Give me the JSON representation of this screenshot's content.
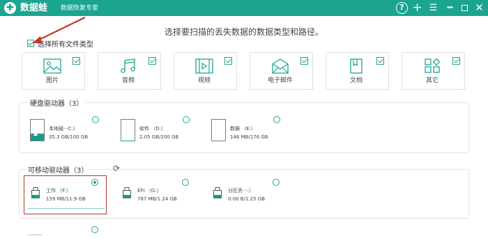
{
  "titlebar": {
    "app_name": "数据蛙",
    "subtitle": "数据恢复专家",
    "logo_glyph": "✚"
  },
  "instruction": "选择要扫描的丢失数据的数据类型和路径。",
  "select_all_label": "选择所有文件类型",
  "file_types": [
    {
      "label": "图片",
      "checked": true
    },
    {
      "label": "音频",
      "checked": true
    },
    {
      "label": "视频",
      "checked": true
    },
    {
      "label": "电子邮件",
      "checked": true
    },
    {
      "label": "文档",
      "checked": true
    },
    {
      "label": "其它",
      "checked": true
    }
  ],
  "hard_drives": {
    "title": "硬盘驱动器（3）",
    "items": [
      {
        "name": "本地磁···C:）",
        "size": "35.3 GB/100 GB",
        "used_fraction": 0.35
      },
      {
        "name": "软件 （D:）",
        "size": "2.05 GB/200 GB",
        "used_fraction": 0.01
      },
      {
        "name": "数据 （E:）",
        "size": "146 MB/176 GB",
        "used_fraction": 0.0
      }
    ]
  },
  "removable": {
    "title": "可移动驱动器（3）",
    "items": [
      {
        "name": "工作 （F:）",
        "size": "159 MB/11.9 GB",
        "selected": true
      },
      {
        "name": "EFI （G:）",
        "size": "787 MB/1.24 GB",
        "selected": false
      },
      {
        "name": "分区丢···:）",
        "size": "0.00  B/1.25 GB",
        "selected": false
      }
    ]
  },
  "colors": {
    "accent": "#1ba591",
    "highlight_border": "#b23a32",
    "arrow": "#c0392b"
  }
}
